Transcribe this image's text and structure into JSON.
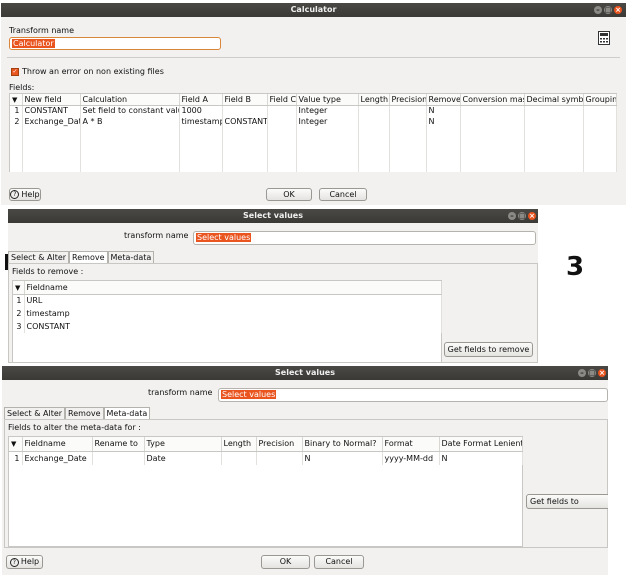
{
  "calculator": {
    "title": "Calculator",
    "transform_name_label": "Transform name",
    "transform_name_value": "Calculator",
    "checkbox_label": "Throw an error on non existing files",
    "fields_label": "Fields:",
    "columns": [
      "#",
      "New field",
      "Calculation",
      "Field A",
      "Field B",
      "Field C",
      "Value type",
      "Length",
      "Precision",
      "Remove",
      "Conversion mask",
      "Decimal symbol",
      "Groupin"
    ],
    "rows": [
      [
        "1",
        "CONSTANT",
        "Set field to constant value A",
        "1000",
        "",
        "",
        "Integer",
        "",
        "",
        "N",
        "",
        "",
        ""
      ],
      [
        "2",
        "Exchange_Date",
        "A * B",
        "timestamp",
        "CONSTANT",
        "",
        "Integer",
        "",
        "",
        "N",
        "",
        "",
        ""
      ]
    ],
    "help": "Help",
    "ok": "OK",
    "cancel": "Cancel"
  },
  "select_values_remove": {
    "title": "Select values",
    "transform_name_label": "transform name",
    "transform_name_value": "Select values",
    "tabs": [
      "Select & Alter",
      "Remove",
      "Meta-data"
    ],
    "fields_label": "Fields to remove :",
    "column": "Fieldname",
    "rows": [
      [
        "1",
        "URL"
      ],
      [
        "2",
        "timestamp"
      ],
      [
        "3",
        "CONSTANT"
      ]
    ],
    "get_fields": "Get fields to remove"
  },
  "annotation": "3",
  "select_values_meta": {
    "title": "Select values",
    "transform_name_label": "transform name",
    "transform_name_value": "Select values",
    "tabs": [
      "Select & Alter",
      "Remove",
      "Meta-data"
    ],
    "fields_label": "Fields to alter the meta-data for :",
    "columns": [
      "Fieldname",
      "Rename to",
      "Type",
      "Length",
      "Precision",
      "Binary to Normal?",
      "Format",
      "Date Format Lenient"
    ],
    "rows": [
      [
        "1",
        "Exchange_Date",
        "",
        "Date",
        "",
        "",
        "N",
        "yyyy-MM-dd",
        "N"
      ]
    ],
    "get_fields": "Get fields to change",
    "help": "Help",
    "ok": "OK",
    "cancel": "Cancel"
  },
  "window_controls": {
    "minimize": "–",
    "maximize": "□",
    "close": "×"
  }
}
